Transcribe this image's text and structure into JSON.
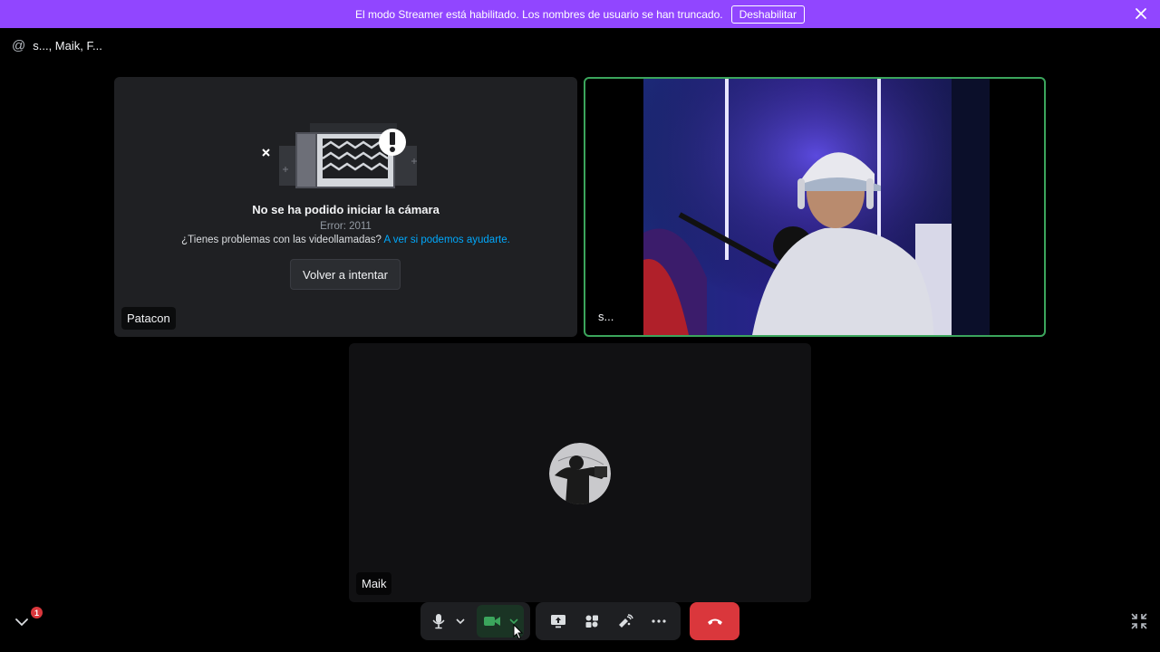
{
  "banner": {
    "text": "El modo Streamer está habilitado. Los nombres de usuario se han truncado.",
    "button_label": "Deshabilitar",
    "color": "#9146ff"
  },
  "channel": {
    "icon": "at-icon",
    "name": "s..., Maik, F..."
  },
  "tiles": [
    {
      "user": "Patacon",
      "error_title": "No se ha podido iniciar la cámara",
      "error_code": "Error: 2011",
      "help_text": "¿Tienes problemas con las videollamadas?",
      "help_link": "A ver si podemos ayudarte.",
      "retry_label": "Volver a intentar"
    },
    {
      "user": "s...",
      "speaking": true
    },
    {
      "user": "Maik"
    }
  ],
  "controls": {
    "mic_icon": "microphone-icon",
    "camera_icon": "video-camera-icon",
    "screenshare_icon": "screen-share-icon",
    "activities_icon": "activities-icon",
    "soundboard_icon": "soundboard-icon",
    "more_icon": "more-icon",
    "hangup_icon": "hangup-icon",
    "notification_count": "1"
  },
  "colors": {
    "accent_green": "#3ba55c",
    "danger": "#da373c",
    "link": "#00a8fc"
  }
}
